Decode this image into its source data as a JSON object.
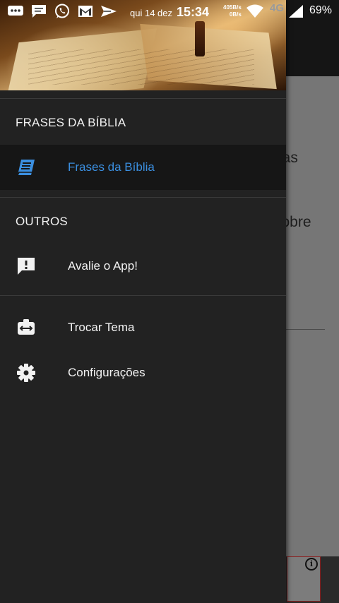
{
  "status_bar": {
    "date": "qui 14 dez",
    "time": "15:34",
    "speed_up": "405B/s",
    "speed_down": "0B/s",
    "network": "4G",
    "battery": "69%",
    "notification_icons": [
      "messaging-icon",
      "chat-icon",
      "whatsapp-icon",
      "gmail-icon",
      "send-icon"
    ]
  },
  "drawer": {
    "section_main": {
      "title": "FRASES DA BÍBLIA",
      "items": [
        {
          "label": "Frases da Bíblia",
          "icon": "book-icon",
          "active": true
        }
      ]
    },
    "section_other": {
      "title": "OUTROS",
      "items": [
        {
          "label": "Avalie o App!",
          "icon": "feedback-icon"
        },
        {
          "label": "Trocar Tema",
          "icon": "swap-theme-icon"
        },
        {
          "label": "Configurações",
          "icon": "settings-icon"
        }
      ]
    }
  },
  "background_app": {
    "text_fragments": [
      "nas",
      ",",
      "sobre"
    ]
  },
  "colors": {
    "accent": "#3b8fe0",
    "drawer_bg": "#222222",
    "active_bg": "#161616"
  }
}
